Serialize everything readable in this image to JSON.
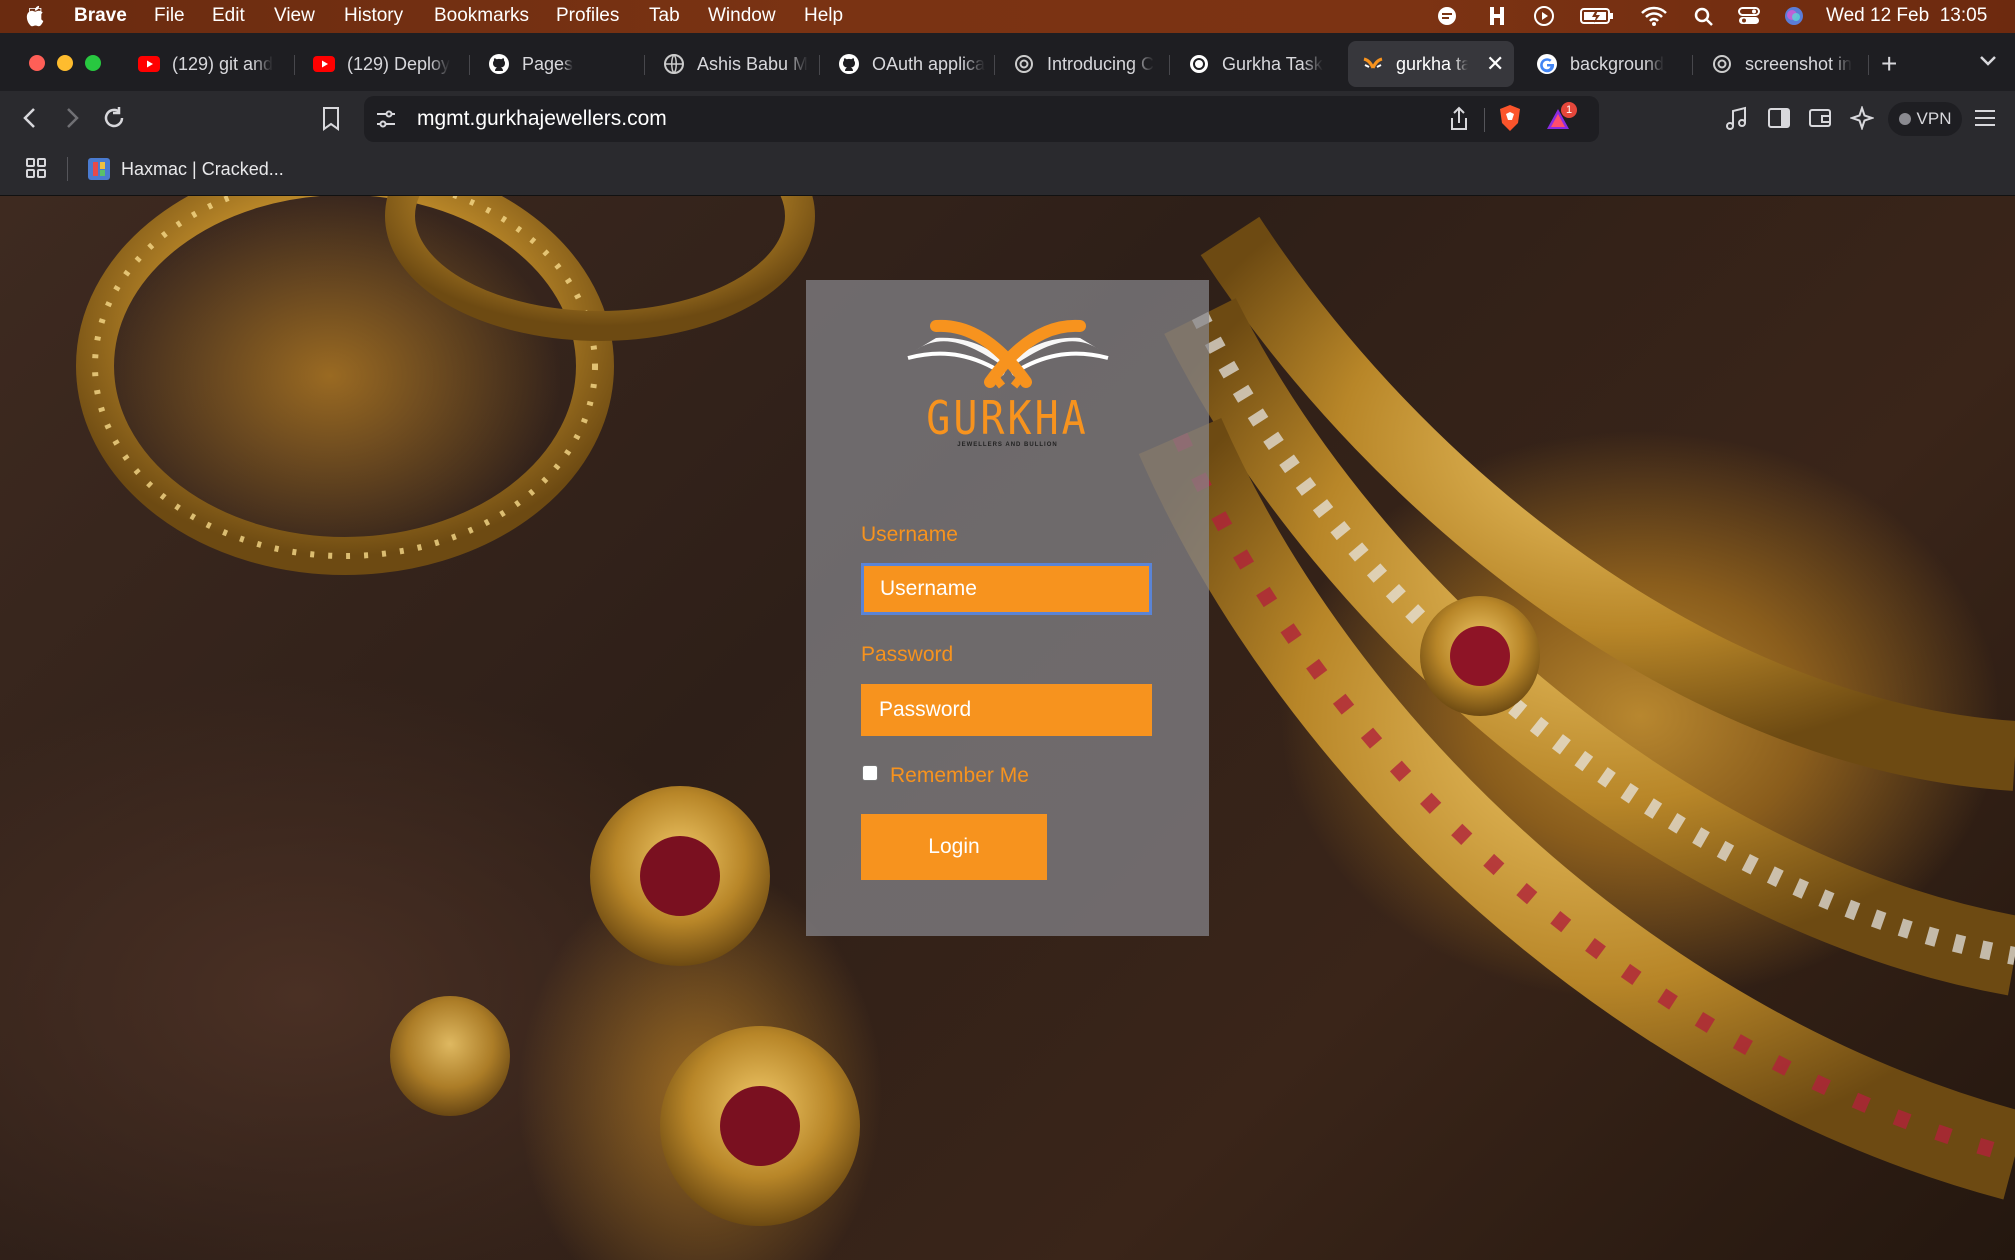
{
  "menubar": {
    "app_name": "Brave",
    "items": [
      "File",
      "Edit",
      "View",
      "History",
      "Bookmarks",
      "Profiles",
      "Tab",
      "Window",
      "Help"
    ],
    "clock": "Wed 12 Feb  13:05"
  },
  "tabs": [
    {
      "title": "(129) git and",
      "icon": "youtube-icon"
    },
    {
      "title": "(129) Deploy",
      "icon": "youtube-icon"
    },
    {
      "title": "Pages",
      "icon": "github-icon"
    },
    {
      "title": "Ashis Babu M",
      "icon": "globe-icon"
    },
    {
      "title": "OAuth applica",
      "icon": "github-icon"
    },
    {
      "title": "Introducing C",
      "icon": "openai-icon"
    },
    {
      "title": "Gurkha Task",
      "icon": "openai-icon"
    },
    {
      "title": "gurkha ta",
      "icon": "gurkha-favicon",
      "active": true
    },
    {
      "title": "background",
      "icon": "google-icon"
    },
    {
      "title": "screenshot in",
      "icon": "openai-icon"
    }
  ],
  "toolbar": {
    "url": "mgmt.gurkhajewellers.com",
    "shield_badge": "1",
    "vpn_label": "VPN"
  },
  "bookmarks": {
    "items": [
      {
        "title": "Haxmac | Cracked..."
      }
    ]
  },
  "login": {
    "logo_text": "GURKHA",
    "logo_subtext": "JEWELLERS AND BULLION",
    "username_label": "Username",
    "username_placeholder": "Username",
    "password_label": "Password",
    "password_placeholder": "Password",
    "remember_label": "Remember Me",
    "remember_checked": false,
    "login_button": "Login"
  },
  "colors": {
    "accent": "#f7931e",
    "card_bg": "#87878c",
    "menubar": "#7a3313",
    "browser_chrome": "#2a2a2e"
  }
}
